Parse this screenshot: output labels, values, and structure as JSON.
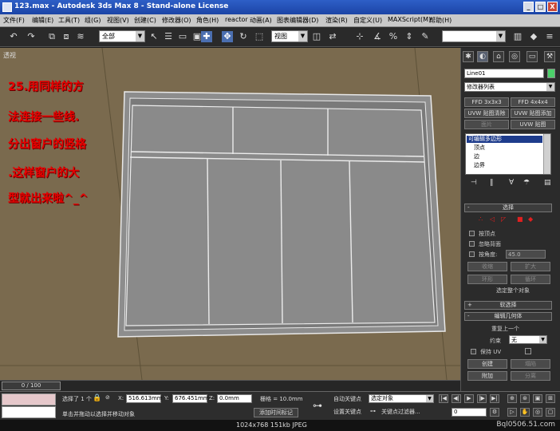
{
  "window": {
    "title": "123.max - Autodesk 3ds Max 8 - Stand-alone License",
    "min": "_",
    "max": "□",
    "close": "X"
  },
  "menu": [
    "文件(F)",
    "编辑(E)",
    "工具(T)",
    "组(G)",
    "视图(V)",
    "创建(C)",
    "修改器(O)",
    "角色(H)",
    "reactor",
    "动画(A)",
    "图表编辑器(D)",
    "渲染(R)",
    "自定义(U)",
    "MAXScript(M)",
    "帮助(H)"
  ],
  "toolbar": {
    "selection_filter": "全部",
    "ref_coord": "视图",
    "named_selection": ""
  },
  "viewport": {
    "label": "透视",
    "note_lines": [
      "25.用同样的方",
      "法连接一些线.",
      "分出窗户的竖格",
      ".这样窗户的大",
      "型就出来啦^_^"
    ]
  },
  "cmd": {
    "object_name": "Line01",
    "modifier_list": "修改器列表",
    "buttons": [
      [
        "FFD 3x3x3",
        "FFD 4x4x4"
      ],
      [
        "UVW 贴图清除",
        "UVW 贴图添加"
      ],
      [
        "面片",
        "UVW 贴图"
      ]
    ],
    "stack": [
      "可编辑多边形",
      "顶点",
      "边",
      "边界"
    ],
    "selection_title": "选择",
    "by_vertex": "按顶点",
    "ignore_backfacing": "忽略背面",
    "by_angle": "按角度:",
    "angle": "45.0",
    "shrink": "收缩",
    "grow": "扩大",
    "ring": "环形",
    "loop": "循环",
    "select_all_obj": "选定整个对象",
    "soft_selection": "软选择",
    "edit_geometry": "编辑几何体",
    "repeat_last": "重复上一个",
    "constraint_label": "约束",
    "constraint_value": "无",
    "preserve_uv": "保持 UV",
    "create": "创建",
    "collapse": "塌陷",
    "attach": "附加",
    "detach": "分离"
  },
  "timeslider": {
    "frame": "0 / 100"
  },
  "status": {
    "selected": "选择了 1 个",
    "x_label": "X:",
    "x_val": "516.613mm",
    "y_label": "Y:",
    "y_val": "676.451mm",
    "z_label": "Z:",
    "z_val": "0.0mm",
    "grid": "栅格 = 10.0mm",
    "prompt": "单击并拖动以选择并移动对象",
    "add_time_tag": "添加时间标记",
    "auto_key": "自动关键点",
    "set_key": "设置关键点",
    "selected_obj": "选定对象",
    "key_filters": "关键点过滤器...",
    "frame_field": "0"
  },
  "footer": {
    "info": "1024x768  151kb  JPEG",
    "watermark": "Bql0506.51.com"
  }
}
